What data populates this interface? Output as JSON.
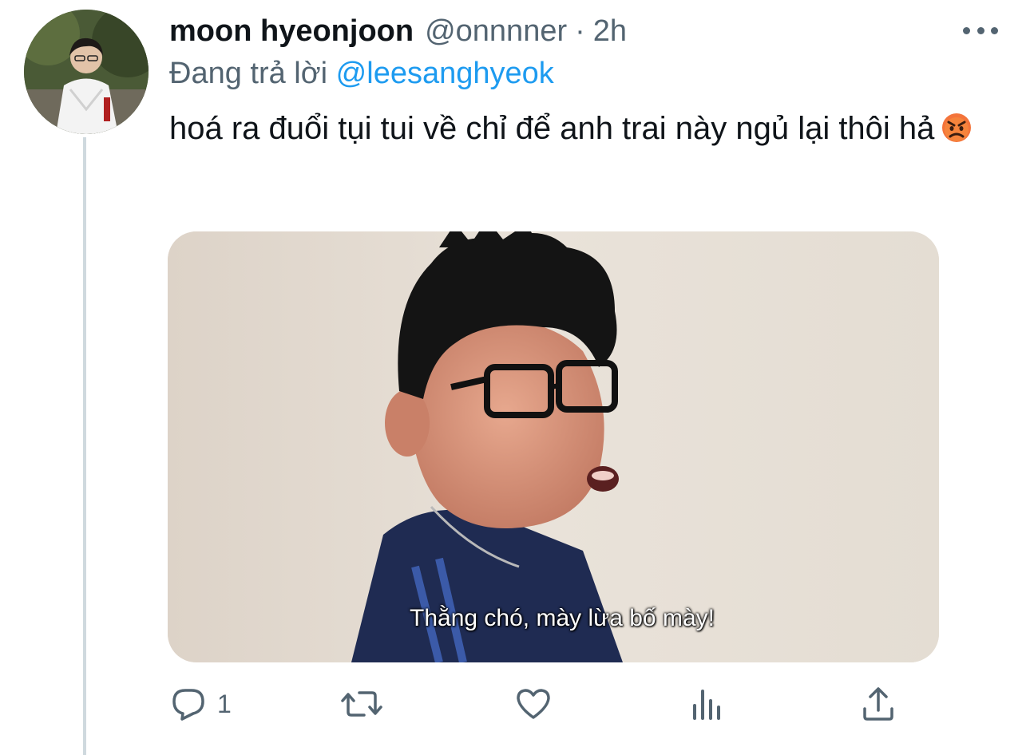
{
  "tweet": {
    "author_name": "moon hyeonjoon",
    "author_handle": "@onnnner",
    "separator": "·",
    "timestamp": "2h",
    "reply_prefix": "Đang trả lời",
    "reply_mention": "@leesanghyeok",
    "text": "hoá ra đuổi tụi tui về chỉ để anh trai này ngủ lại thôi hả",
    "emoji": "angry-face-emoji"
  },
  "media": {
    "subtitle": "Thằng chó, mày lừa bố mày!"
  },
  "actions": [
    {
      "name": "reply",
      "icon": "reply-bubble-icon",
      "count": "1"
    },
    {
      "name": "retweet",
      "icon": "retweet-icon",
      "count": ""
    },
    {
      "name": "like",
      "icon": "heart-icon",
      "count": ""
    },
    {
      "name": "analytics",
      "icon": "bar-chart-icon",
      "count": ""
    },
    {
      "name": "share",
      "icon": "share-icon",
      "count": ""
    }
  ],
  "colors": {
    "accent": "#1d9bf0",
    "text_primary": "#0f1419",
    "text_secondary": "#536471",
    "thread_line": "#cfd9de"
  }
}
